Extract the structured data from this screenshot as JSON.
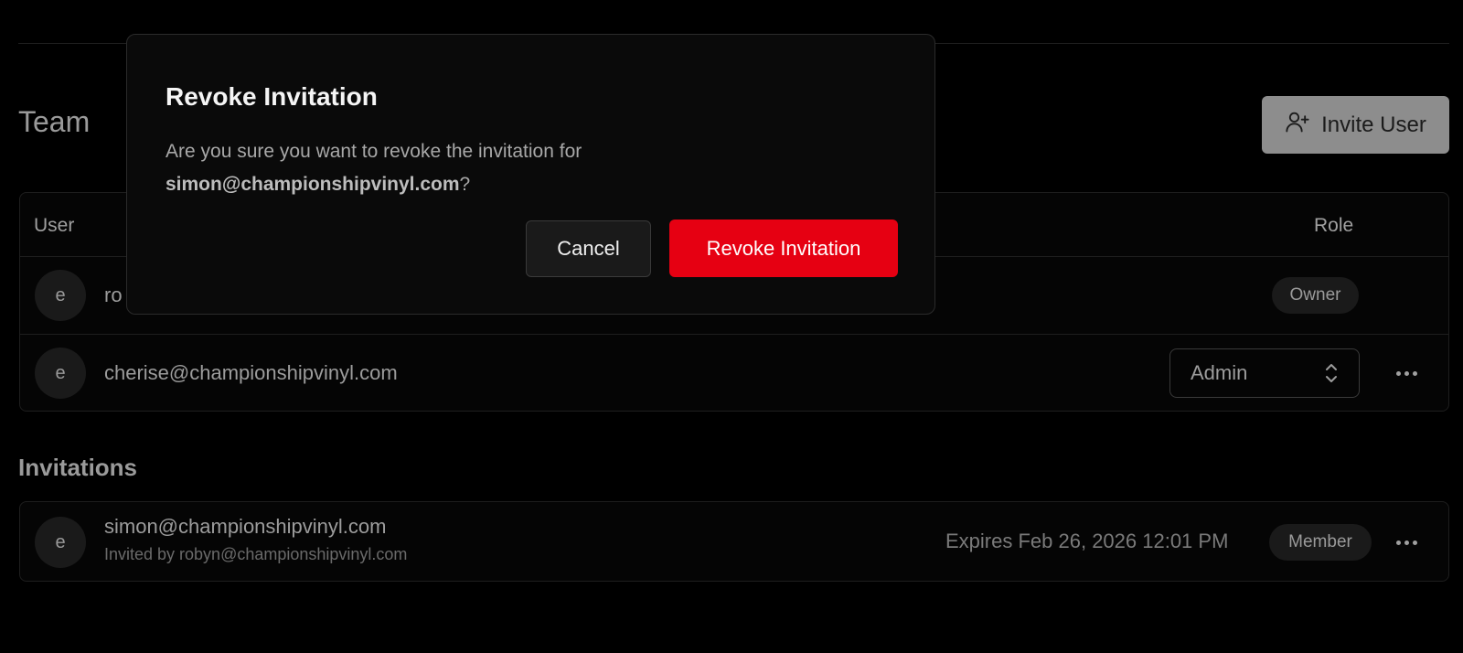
{
  "header": {
    "team_title": "Team",
    "invite_button_label": "Invite User",
    "invite_icon": "user-plus-icon"
  },
  "members": {
    "columns": {
      "user": "User",
      "role": "Role"
    },
    "rows": [
      {
        "avatar": "e",
        "email": "ro",
        "role_badge": "Owner"
      },
      {
        "avatar": "e",
        "email": "cherise@championshipvinyl.com",
        "role_select": "Admin"
      }
    ]
  },
  "invitations": {
    "title": "Invitations",
    "rows": [
      {
        "avatar": "e",
        "email": "simon@championshipvinyl.com",
        "invited_by": "Invited by robyn@championshipvinyl.com",
        "expires": "Expires Feb 26, 2026 12:01 PM",
        "role_badge": "Member"
      }
    ]
  },
  "modal": {
    "title": "Revoke Invitation",
    "body_prefix": "Are you sure you want to revoke the invitation for",
    "body_email": "simon@championshipvinyl.com",
    "body_suffix": "?",
    "cancel_label": "Cancel",
    "confirm_label": "Revoke Invitation",
    "confirm_color": "#e60012"
  }
}
